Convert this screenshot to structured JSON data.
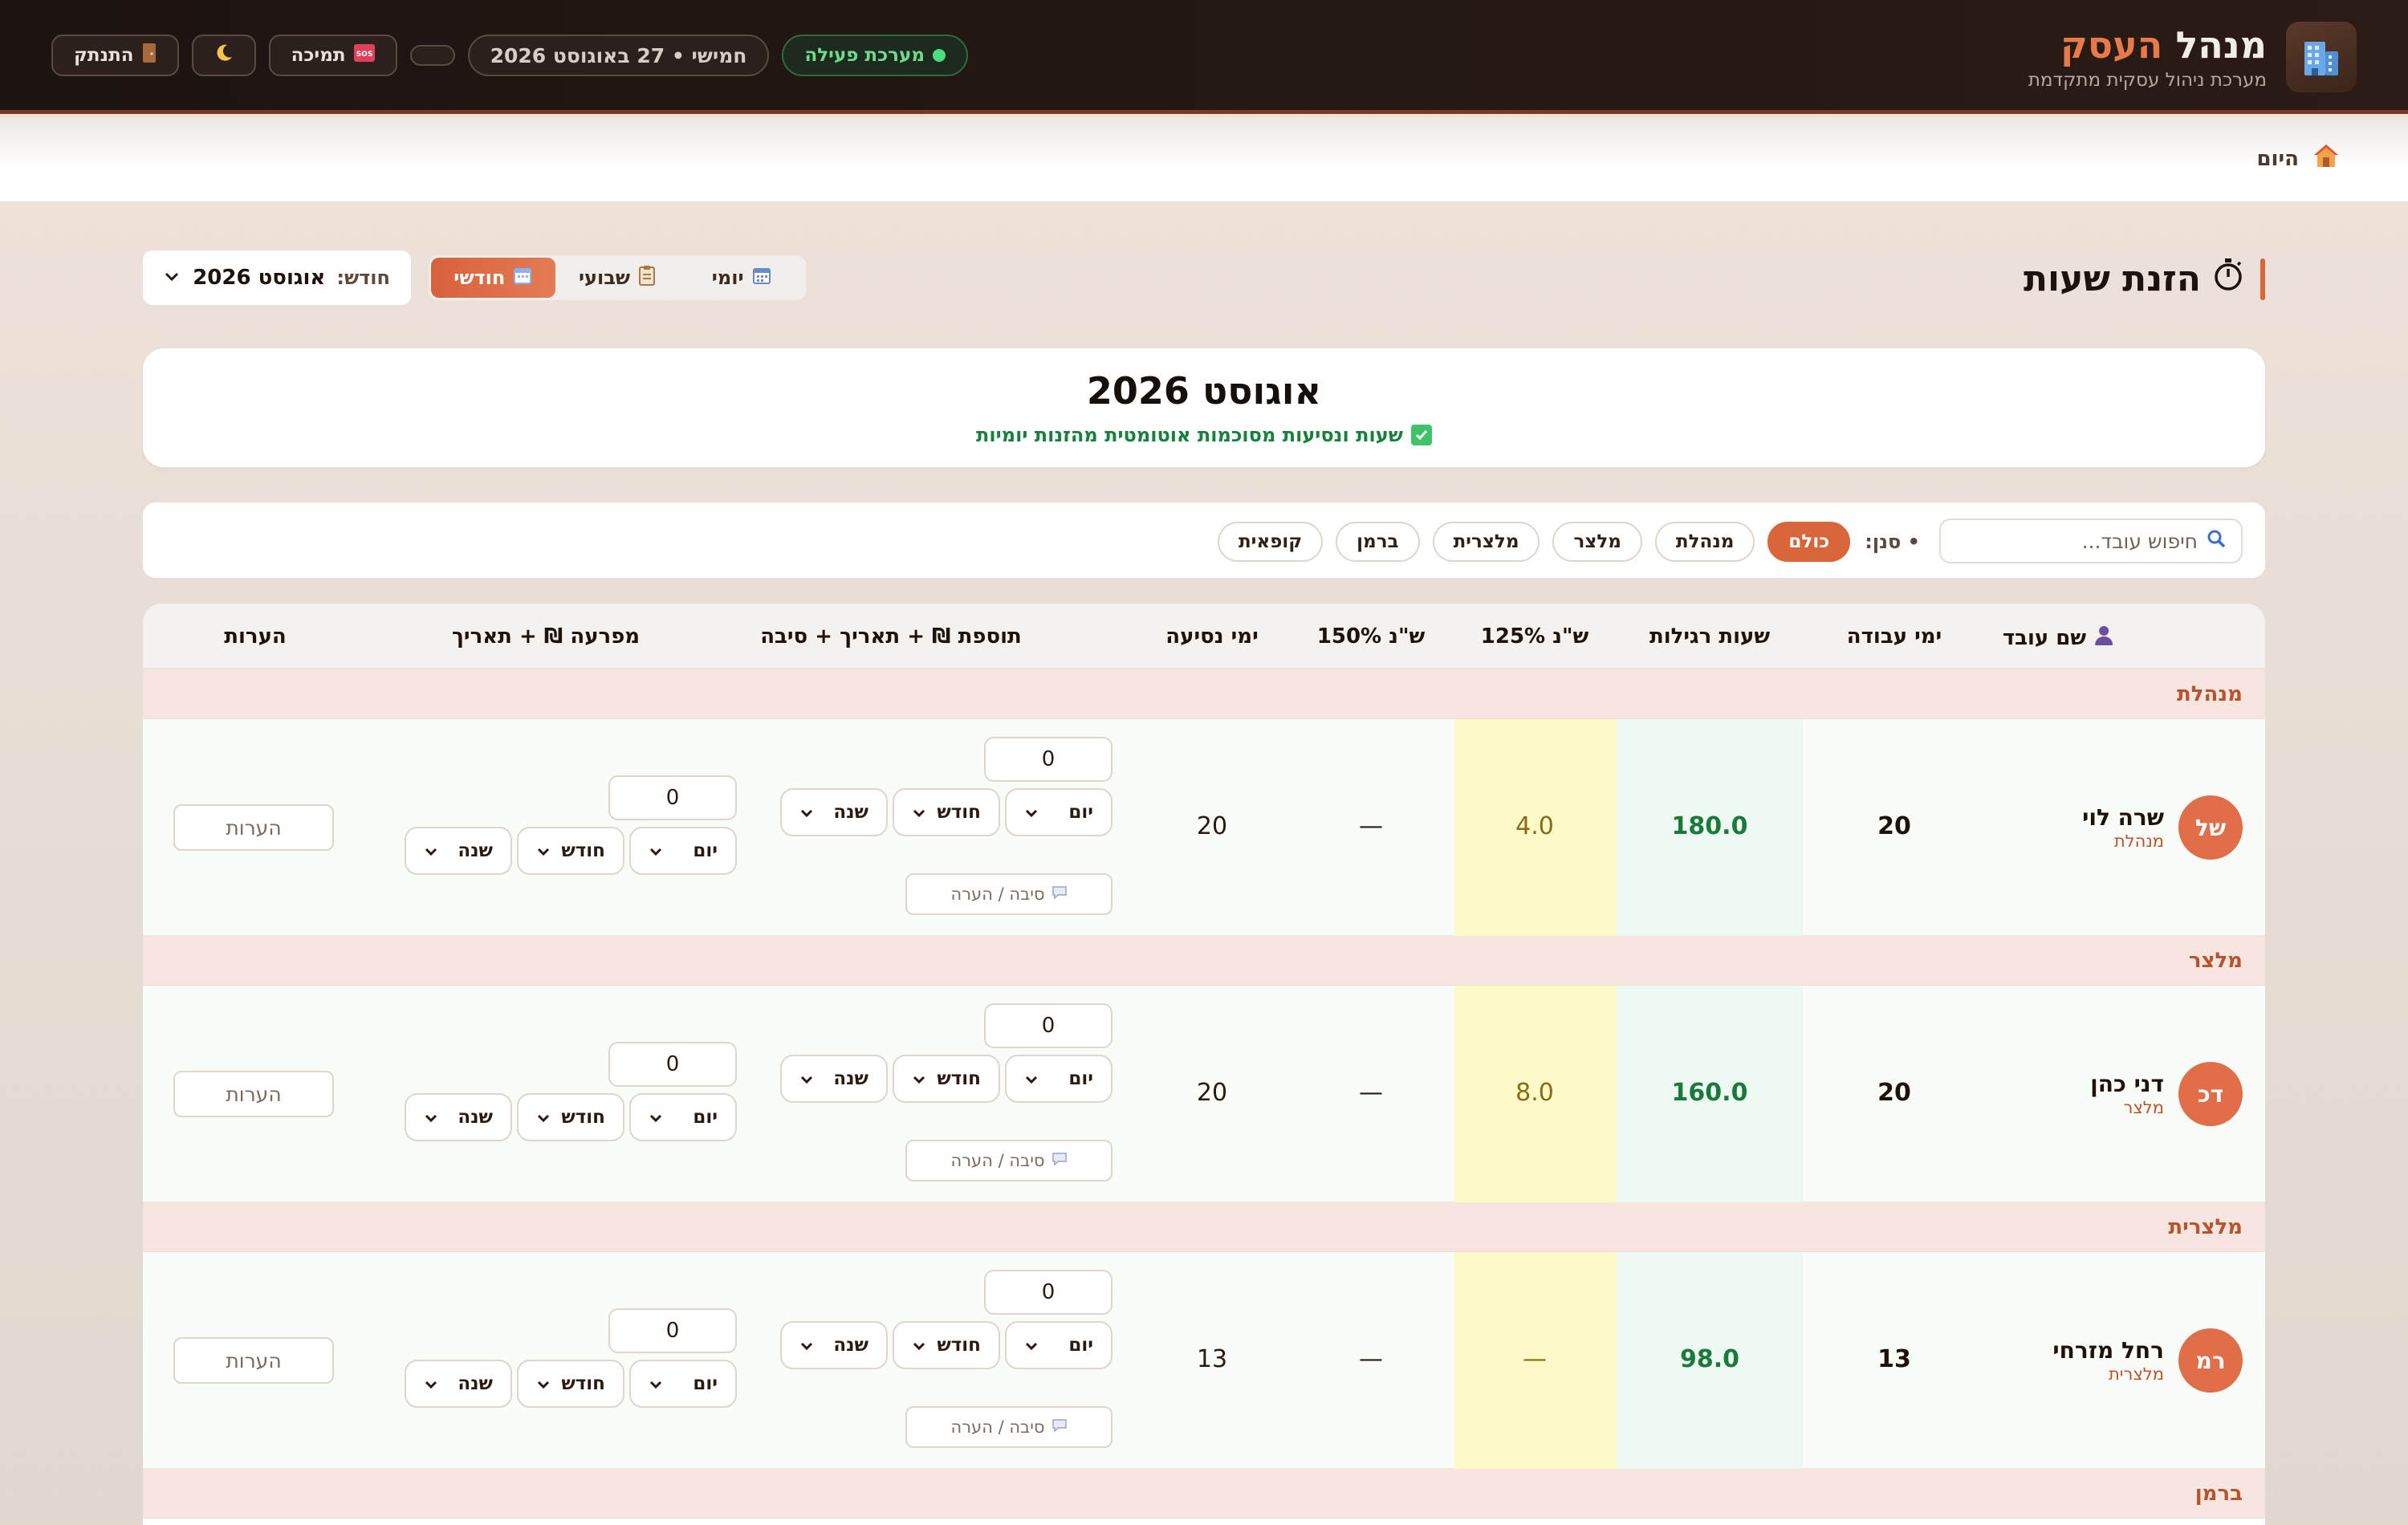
{
  "header": {
    "brand_title_dark": "מנהל",
    "brand_title_accent": "העסק",
    "brand_subtitle": "מערכת ניהול עסקית מתקדמת",
    "status_label": "מערכת פעילה",
    "date_label": "חמישי • 27 באוגוסט 2026",
    "support_label": "תמיכה",
    "logout_label": "התנתק",
    "icons": {
      "logo": "building-icon",
      "theme": "moon-icon",
      "support": "sos-icon",
      "logout": "door-icon"
    }
  },
  "breadcrumb": {
    "label": "היום"
  },
  "page": {
    "title": "הזנת שעות",
    "view_tabs": [
      {
        "label": "יומי",
        "active": false
      },
      {
        "label": "שבועי",
        "active": false
      },
      {
        "label": "חודשי",
        "active": true
      }
    ],
    "month_label": "חודש:",
    "month_value": "אוגוסט 2026"
  },
  "month_card": {
    "title": "אוגוסט 2026",
    "subtitle": "שעות ונסיעות מסוכמות אוטומטית מהזנות יומיות"
  },
  "filters": {
    "search_placeholder": "חיפוש עובד...",
    "filter_label": "סנן:",
    "chips": [
      {
        "label": "כולם",
        "active": true
      },
      {
        "label": "מנהלת",
        "active": false
      },
      {
        "label": "מלצר",
        "active": false
      },
      {
        "label": "מלצרית",
        "active": false
      },
      {
        "label": "ברמן",
        "active": false
      },
      {
        "label": "קופאית",
        "active": false
      }
    ]
  },
  "table": {
    "columns": {
      "name": "שם עובד",
      "work_days": "ימי עבודה",
      "regular": "שעות רגילות",
      "ot125": "ש\"נ 125%",
      "ot150": "ש\"נ 150%",
      "travel": "ימי נסיעה",
      "bonus": "תוספת ₪ + תאריך + סיבה",
      "advance": "מפרעה ₪ + תאריך",
      "notes": "הערות"
    },
    "day_label": "יום",
    "month_sel_label": "חודש",
    "year_label": "שנה",
    "reason_placeholder": "סיבה / הערה",
    "notes_placeholder": "הערות",
    "groups": [
      {
        "name": "מנהלת",
        "rows": [
          {
            "initials": "של",
            "name": "שרה לוי",
            "role": "מנהלת",
            "work_days": "20",
            "regular": "180.0",
            "ot125": "4.0",
            "ot150": "—",
            "travel": "20",
            "bonus": "0",
            "advance": "0"
          }
        ]
      },
      {
        "name": "מלצר",
        "rows": [
          {
            "initials": "דכ",
            "name": "דני כהן",
            "role": "מלצר",
            "work_days": "20",
            "regular": "160.0",
            "ot125": "8.0",
            "ot150": "—",
            "travel": "20",
            "bonus": "0",
            "advance": "0"
          }
        ]
      },
      {
        "name": "מלצרית",
        "rows": [
          {
            "initials": "רמ",
            "name": "רחל מזרחי",
            "role": "מלצרית",
            "work_days": "13",
            "regular": "98.0",
            "ot125": "—",
            "ot150": "—",
            "travel": "13",
            "bonus": "0",
            "advance": "0"
          }
        ]
      },
      {
        "name": "ברמן",
        "rows": []
      }
    ]
  },
  "colors": {
    "accent": "#d9653b",
    "positive": "#1a7a3c",
    "header_bg": "#1c1411"
  }
}
